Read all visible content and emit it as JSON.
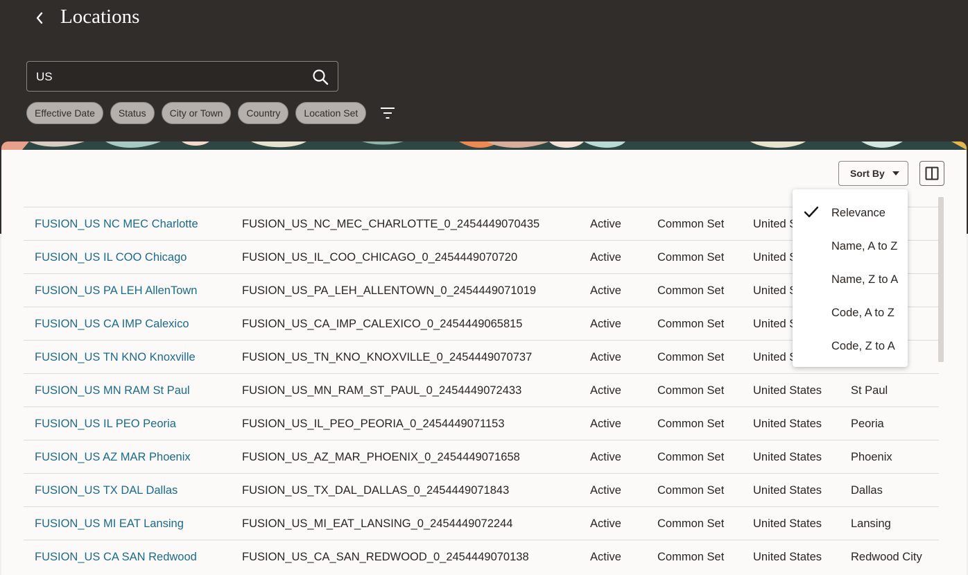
{
  "header": {
    "title": "Locations",
    "back_label": "Back"
  },
  "search": {
    "value": "US"
  },
  "filters": [
    "Effective Date",
    "Status",
    "City or Town",
    "Country",
    "Location Set"
  ],
  "toolbar": {
    "sort_label": "Sort By"
  },
  "sort_menu": {
    "items": [
      {
        "label": "Relevance",
        "selected": true
      },
      {
        "label": "Name, A to Z",
        "selected": false
      },
      {
        "label": "Name, Z to A",
        "selected": false
      },
      {
        "label": "Code, A to Z",
        "selected": false
      },
      {
        "label": "Code, Z to A",
        "selected": false
      }
    ]
  },
  "rows": [
    {
      "name": "FUSION_US NC MEC Charlotte",
      "code": "FUSION_US_NC_MEC_CHARLOTTE_0_2454449070435",
      "status": "Active",
      "set": "Common Set",
      "country": "United S",
      "city": ""
    },
    {
      "name": "FUSION_US IL COO Chicago",
      "code": "FUSION_US_IL_COO_CHICAGO_0_2454449070720",
      "status": "Active",
      "set": "Common Set",
      "country": "United S",
      "city": ""
    },
    {
      "name": "FUSION_US PA LEH AllenTown",
      "code": "FUSION_US_PA_LEH_ALLENTOWN_0_2454449071019",
      "status": "Active",
      "set": "Common Set",
      "country": "United S",
      "city": ""
    },
    {
      "name": "FUSION_US CA IMP Calexico",
      "code": "FUSION_US_CA_IMP_CALEXICO_0_2454449065815",
      "status": "Active",
      "set": "Common Set",
      "country": "United S",
      "city": ""
    },
    {
      "name": "FUSION_US TN KNO Knoxville",
      "code": "FUSION_US_TN_KNO_KNOXVILLE_0_2454449070737",
      "status": "Active",
      "set": "Common Set",
      "country": "United S",
      "city": ""
    },
    {
      "name": "FUSION_US MN RAM St Paul",
      "code": "FUSION_US_MN_RAM_ST_PAUL_0_2454449072433",
      "status": "Active",
      "set": "Common Set",
      "country": "United States",
      "city": "St Paul"
    },
    {
      "name": "FUSION_US IL PEO Peoria",
      "code": "FUSION_US_IL_PEO_PEORIA_0_2454449071153",
      "status": "Active",
      "set": "Common Set",
      "country": "United States",
      "city": "Peoria"
    },
    {
      "name": "FUSION_US AZ MAR Phoenix",
      "code": "FUSION_US_AZ_MAR_PHOENIX_0_2454449071658",
      "status": "Active",
      "set": "Common Set",
      "country": "United States",
      "city": "Phoenix"
    },
    {
      "name": "FUSION_US TX DAL Dallas",
      "code": "FUSION_US_TX_DAL_DALLAS_0_2454449071843",
      "status": "Active",
      "set": "Common Set",
      "country": "United States",
      "city": "Dallas"
    },
    {
      "name": "FUSION_US MI EAT Lansing",
      "code": "FUSION_US_MI_EAT_LANSING_0_2454449072244",
      "status": "Active",
      "set": "Common Set",
      "country": "United States",
      "city": "Lansing"
    },
    {
      "name": "FUSION_US CA SAN Redwood",
      "code": "FUSION_US_CA_SAN_REDWOOD_0_2454449070138",
      "status": "Active",
      "set": "Common Set",
      "country": "United States",
      "city": "Redwood City"
    }
  ],
  "colors": {
    "header_bg": "#312d2a",
    "link": "#1a6b8f",
    "chip_bg": "#b5b0ac",
    "panel_bg": "#fbfaf9"
  }
}
